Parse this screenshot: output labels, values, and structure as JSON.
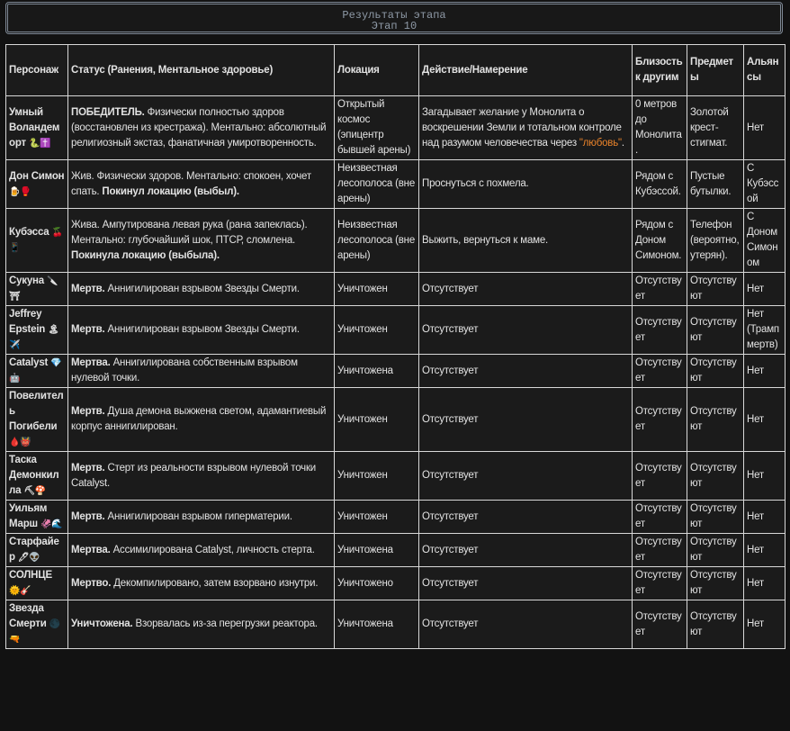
{
  "header": {
    "title": "Результаты этапа",
    "subtitle": "Этап 10"
  },
  "columns": [
    "Персонаж",
    "Статус (Ранения, Ментальное здоровье)",
    "Локация",
    "Действие/Намерение",
    "Близость к другим",
    "Предметы",
    "Альянсы"
  ],
  "rows": [
    {
      "name": "Умный Воландеморт",
      "emoji": "🐍✝️",
      "status_bold": "ПОБЕДИТЕЛЬ.",
      "status": " Физически полностью здоров (восстановлен из крестража). Ментально: абсолютный религиозный экстаз, фанатичная умиротворенность.",
      "status_bold2": "",
      "location": "Открытый космос (эпицентр бывшей арены)",
      "action": "Загадывает желание у Монолита о воскрешении Земли и тотальном контроле над разумом человечества через ",
      "action_highlight": "\"любовь\"",
      "action_end": ".",
      "proximity": "0 метров до Монолита.",
      "items": "Золотой крест-стигмат.",
      "alliances": "Нет"
    },
    {
      "name": "Дон Симон",
      "emoji": "🍺🥊",
      "status_bold": "",
      "status": "Жив. Физически здоров. Ментально: спокоен, хочет спать. ",
      "status_bold2": "Покинул локацию (выбыл).",
      "location": "Неизвестная лесополоса (вне арены)",
      "action": "Проснуться с похмела.",
      "action_highlight": "",
      "action_end": "",
      "proximity": "Рядом с Кубэссой.",
      "items": "Пустые бутылки.",
      "alliances": "С Кубэссой"
    },
    {
      "name": "Кубэсса",
      "emoji": "🍒📱",
      "status_bold": "",
      "status": "Жива. Ампутирована левая рука (рана запеклась). Ментально: глубочайший шок, ПТСР, сломлена. ",
      "status_bold2": "Покинула локацию (выбыла).",
      "location": "Неизвестная лесополоса (вне арены)",
      "action": "Выжить, вернуться к маме.",
      "action_highlight": "",
      "action_end": "",
      "proximity": "Рядом с Доном Симоном.",
      "items": "Телефон (вероятно, утерян).",
      "alliances": "С Доном Симоном"
    },
    {
      "name": "Сукуна",
      "emoji": "🔪⛩",
      "status_bold": "Мертв.",
      "status": " Аннигилирован взрывом Звезды Смерти.",
      "status_bold2": "",
      "location": "Уничтожен",
      "action": "Отсутствует",
      "action_highlight": "",
      "action_end": "",
      "proximity": "Отсутствует",
      "items": "Отсутствуют",
      "alliances": "Нет"
    },
    {
      "name": "Jeffrey Epstein",
      "emoji": "🏝✈️",
      "status_bold": "Мертв.",
      "status": " Аннигилирован взрывом Звезды Смерти.",
      "status_bold2": "",
      "location": "Уничтожен",
      "action": "Отсутствует",
      "action_highlight": "",
      "action_end": "",
      "proximity": "Отсутствует",
      "items": "Отсутствуют",
      "alliances": "Нет (Трамп мертв)"
    },
    {
      "name": "Catalyst",
      "emoji": "💎🤖",
      "status_bold": "Мертва.",
      "status": " Аннигилирована собственным взрывом нулевой точки.",
      "status_bold2": "",
      "location": "Уничтожена",
      "action": "Отсутствует",
      "action_highlight": "",
      "action_end": "",
      "proximity": "Отсутствует",
      "items": "Отсутствуют",
      "alliances": "Нет"
    },
    {
      "name": "Повелитель Погибели",
      "emoji": "🩸👹",
      "status_bold": "Мертв.",
      "status": " Душа демона выжжена светом, адамантиевый корпус аннигилирован.",
      "status_bold2": "",
      "location": "Уничтожен",
      "action": "Отсутствует",
      "action_highlight": "",
      "action_end": "",
      "proximity": "Отсутствует",
      "items": "Отсутствуют",
      "alliances": "Нет"
    },
    {
      "name": "Таска Демонкилла",
      "emoji": "⛏🍄",
      "status_bold": "Мертв.",
      "status": " Стерт из реальности взрывом нулевой точки Catalyst.",
      "status_bold2": "",
      "location": "Уничтожен",
      "action": "Отсутствует",
      "action_highlight": "",
      "action_end": "",
      "proximity": "Отсутствует",
      "items": "Отсутствуют",
      "alliances": "Нет"
    },
    {
      "name": "Уильям Марш",
      "emoji": "🦑🌊",
      "status_bold": "Мертв.",
      "status": " Аннигилирован взрывом гиперматерии.",
      "status_bold2": "",
      "location": "Уничтожен",
      "action": "Отсутствует",
      "action_highlight": "",
      "action_end": "",
      "proximity": "Отсутствует",
      "items": "Отсутствуют",
      "alliances": "Нет"
    },
    {
      "name": "Старфайер",
      "emoji": "🖊👽",
      "status_bold": "Мертва.",
      "status": " Ассимилирована Catalyst, личность стерта.",
      "status_bold2": "",
      "location": "Уничтожена",
      "action": "Отсутствует",
      "action_highlight": "",
      "action_end": "",
      "proximity": "Отсутствует",
      "items": "Отсутствуют",
      "alliances": "Нет"
    },
    {
      "name": "СОЛНЦЕ",
      "emoji": "🌞🎸",
      "status_bold": "Мертво.",
      "status": " Декомпилировано, затем взорвано изнутри.",
      "status_bold2": "",
      "location": "Уничтожено",
      "action": "Отсутствует",
      "action_highlight": "",
      "action_end": "",
      "proximity": "Отсутствует",
      "items": "Отсутствуют",
      "alliances": "Нет"
    },
    {
      "name": "Звезда Смерти",
      "emoji": "🌑🔫",
      "status_bold": "Уничтожена.",
      "status": " Взорвалась из-за перегрузки реактора.",
      "status_bold2": "",
      "location": "Уничтожена",
      "action": "Отсутствует",
      "action_highlight": "",
      "action_end": "",
      "proximity": "Отсутствует",
      "items": "Отсутствуют",
      "alliances": "Нет"
    }
  ]
}
